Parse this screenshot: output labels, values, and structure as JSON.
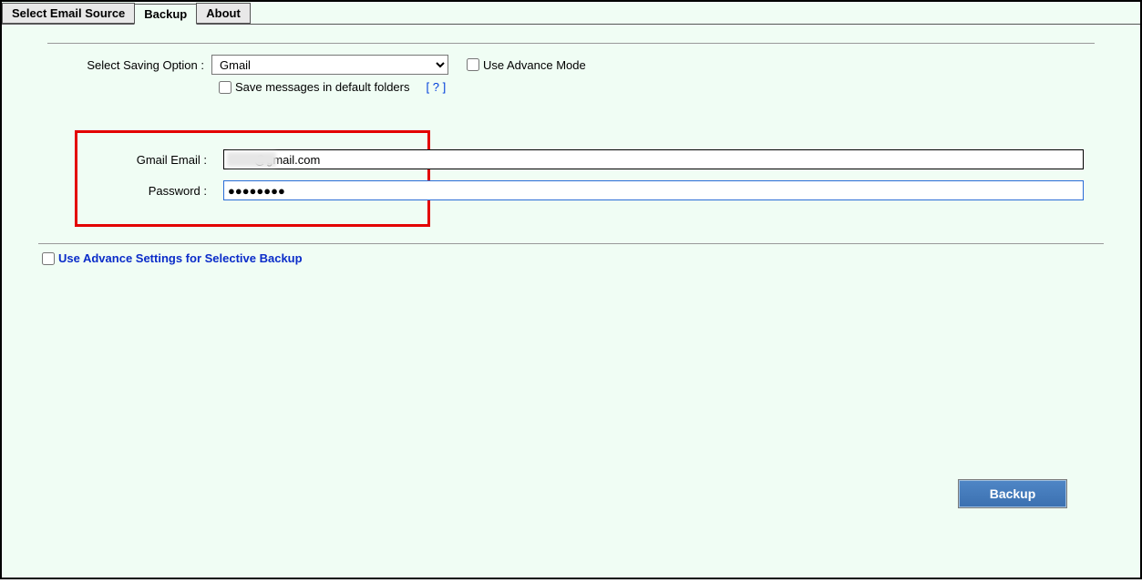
{
  "tabs": {
    "source": "Select Email Source",
    "backup": "Backup",
    "about": "About"
  },
  "saving": {
    "label": "Select Saving Option  :",
    "selected": "Gmail",
    "advance_mode_label": "Use Advance Mode",
    "save_default_label": "Save messages in default folders",
    "help_text": "[ ? ]"
  },
  "cred": {
    "email_label": "Gmail Email  :",
    "email_value": "        @gmail.com",
    "password_label": "Password  :",
    "password_value": "●●●●●●●●"
  },
  "adv": {
    "label": "Use Advance Settings for Selective Backup"
  },
  "buttons": {
    "backup": "Backup"
  }
}
